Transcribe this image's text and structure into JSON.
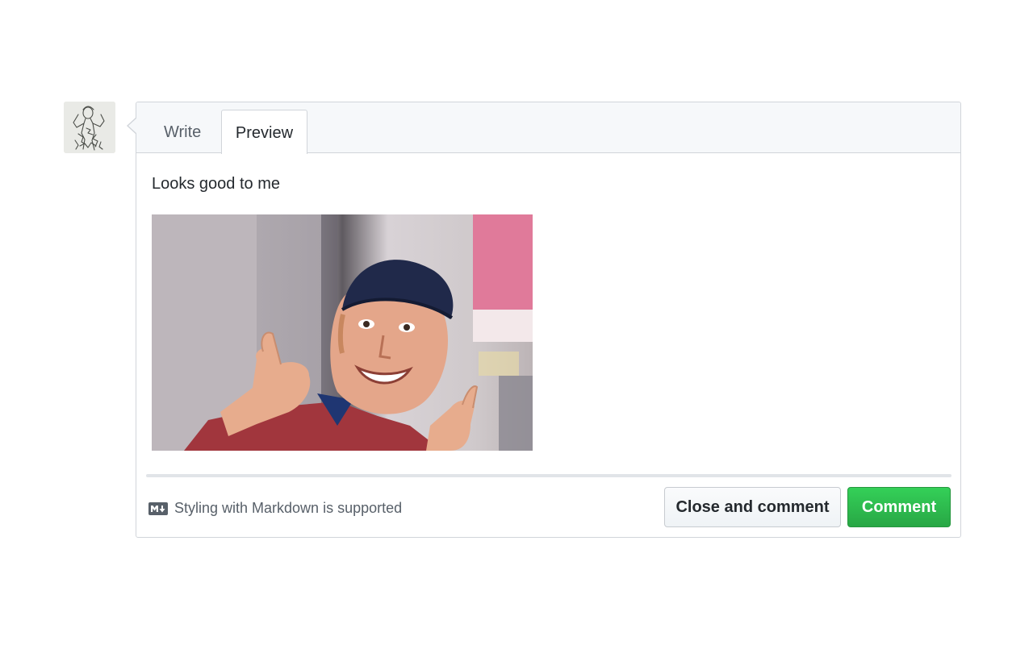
{
  "user": {
    "avatar_icon": "sketch-avatar-icon"
  },
  "tabs": {
    "write_label": "Write",
    "preview_label": "Preview",
    "active": "Preview"
  },
  "preview": {
    "text": "Looks good to me",
    "image_description_icon": "thumbs-up-gif"
  },
  "footer": {
    "markdown_icon": "markdown-icon",
    "markdown_note": "Styling with Markdown is supported",
    "close_comment_label": "Close and comment",
    "comment_label": "Comment"
  },
  "colors": {
    "accent_green": "#2cbe4e",
    "border": "#d1d5da",
    "tab_bg": "#f6f8fa"
  }
}
